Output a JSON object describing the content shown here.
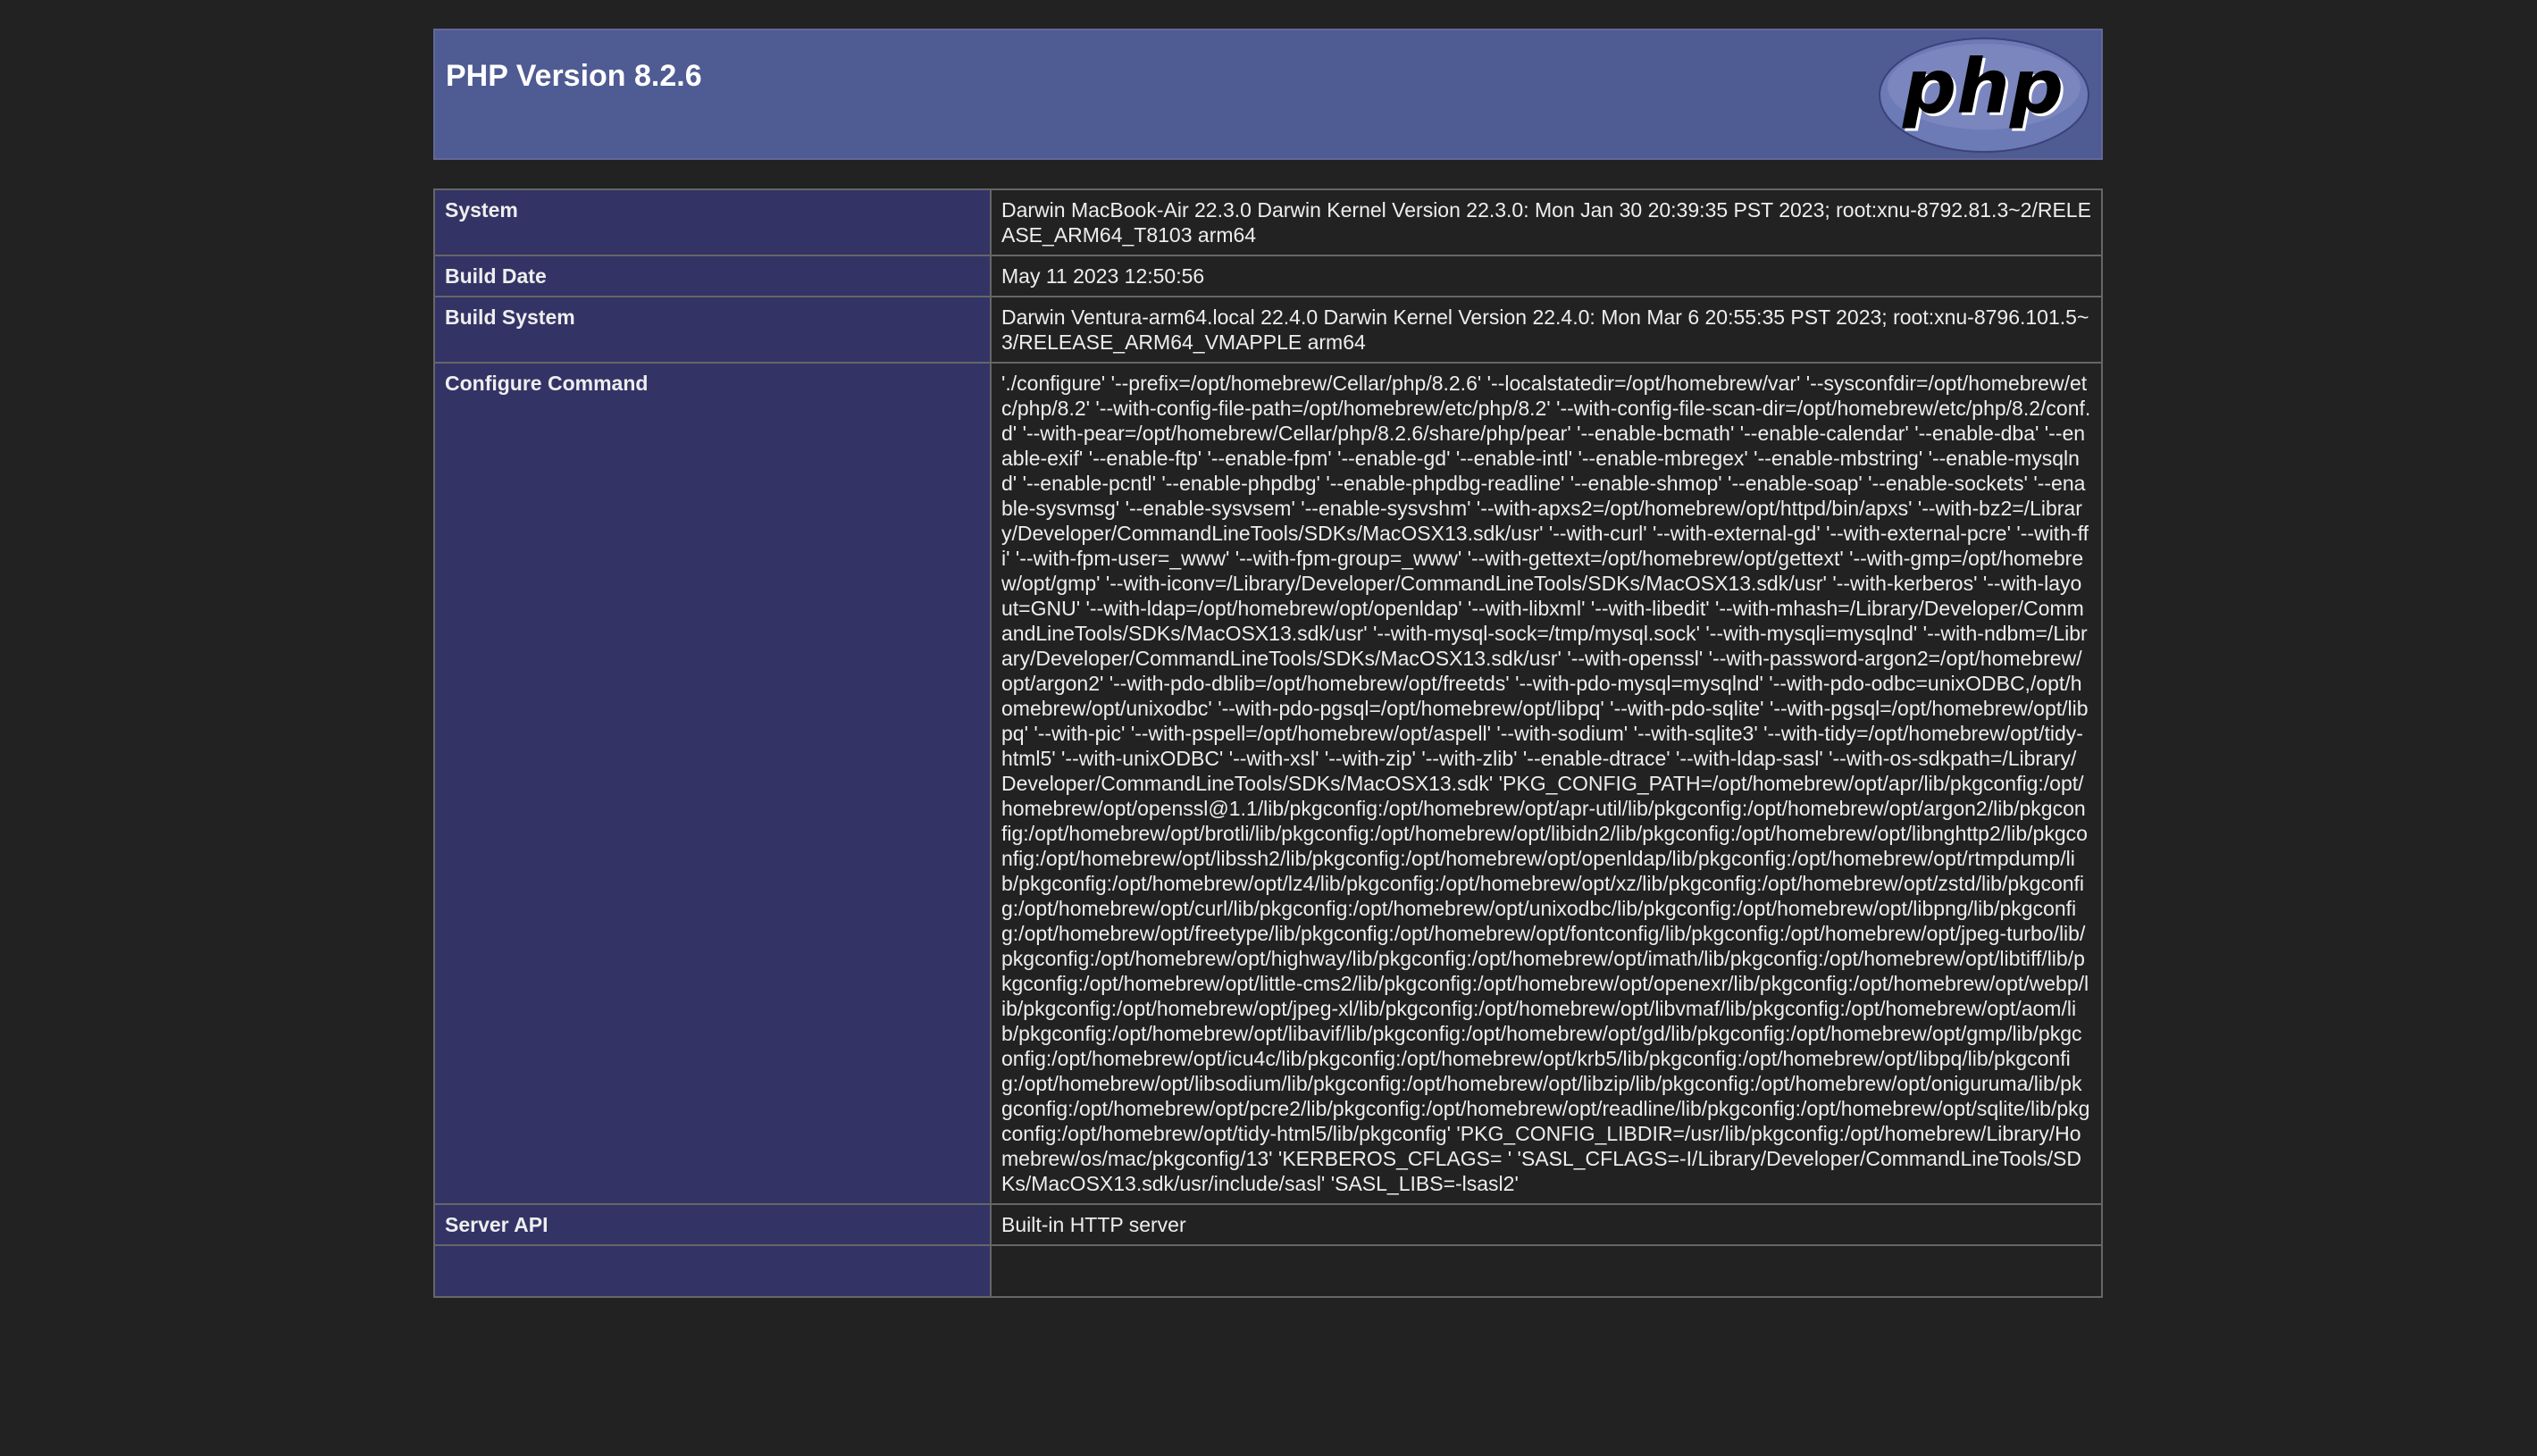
{
  "header": {
    "title": "PHP Version 8.2.6",
    "logo_text": "php",
    "colors": {
      "header_bg": "#4f5b93",
      "label_cell_bg": "#333366",
      "page_bg": "#222222",
      "logo_fill": "#6c7ab5"
    }
  },
  "rows": [
    {
      "label": "System",
      "value": "Darwin MacBook-Air 22.3.0 Darwin Kernel Version 22.3.0: Mon Jan 30 20:39:35 PST 2023; root:xnu-8792.81.3~2/RELEASE_ARM64_T8103 arm64"
    },
    {
      "label": "Build Date",
      "value": "May 11 2023 12:50:56"
    },
    {
      "label": "Build System",
      "value": "Darwin Ventura-arm64.local 22.4.0 Darwin Kernel Version 22.4.0: Mon Mar 6 20:55:35 PST 2023; root:xnu-8796.101.5~3/RELEASE_ARM64_VMAPPLE arm64"
    },
    {
      "label": "Configure Command",
      "value": "'./configure' '--prefix=/opt/homebrew/Cellar/php/8.2.6' '--localstatedir=/opt/homebrew/var' '--sysconfdir=/opt/homebrew/etc/php/8.2' '--with-config-file-path=/opt/homebrew/etc/php/8.2' '--with-config-file-scan-dir=/opt/homebrew/etc/php/8.2/conf.d' '--with-pear=/opt/homebrew/Cellar/php/8.2.6/share/php/pear' '--enable-bcmath' '--enable-calendar' '--enable-dba' '--enable-exif' '--enable-ftp' '--enable-fpm' '--enable-gd' '--enable-intl' '--enable-mbregex' '--enable-mbstring' '--enable-mysqlnd' '--enable-pcntl' '--enable-phpdbg' '--enable-phpdbg-readline' '--enable-shmop' '--enable-soap' '--enable-sockets' '--enable-sysvmsg' '--enable-sysvsem' '--enable-sysvshm' '--with-apxs2=/opt/homebrew/opt/httpd/bin/apxs' '--with-bz2=/Library/Developer/CommandLineTools/SDKs/MacOSX13.sdk/usr' '--with-curl' '--with-external-gd' '--with-external-pcre' '--with-ffi' '--with-fpm-user=_www' '--with-fpm-group=_www' '--with-gettext=/opt/homebrew/opt/gettext' '--with-gmp=/opt/homebrew/opt/gmp' '--with-iconv=/Library/Developer/CommandLineTools/SDKs/MacOSX13.sdk/usr' '--with-kerberos' '--with-layout=GNU' '--with-ldap=/opt/homebrew/opt/openldap' '--with-libxml' '--with-libedit' '--with-mhash=/Library/Developer/CommandLineTools/SDKs/MacOSX13.sdk/usr' '--with-mysql-sock=/tmp/mysql.sock' '--with-mysqli=mysqlnd' '--with-ndbm=/Library/Developer/CommandLineTools/SDKs/MacOSX13.sdk/usr' '--with-openssl' '--with-password-argon2=/opt/homebrew/opt/argon2' '--with-pdo-dblib=/opt/homebrew/opt/freetds' '--with-pdo-mysql=mysqlnd' '--with-pdo-odbc=unixODBC,/opt/homebrew/opt/unixodbc' '--with-pdo-pgsql=/opt/homebrew/opt/libpq' '--with-pdo-sqlite' '--with-pgsql=/opt/homebrew/opt/libpq' '--with-pic' '--with-pspell=/opt/homebrew/opt/aspell' '--with-sodium' '--with-sqlite3' '--with-tidy=/opt/homebrew/opt/tidy-html5' '--with-unixODBC' '--with-xsl' '--with-zip' '--with-zlib' '--enable-dtrace' '--with-ldap-sasl' '--with-os-sdkpath=/Library/Developer/CommandLineTools/SDKs/MacOSX13.sdk' 'PKG_CONFIG_PATH=/opt/homebrew/opt/apr/lib/pkgconfig:/opt/homebrew/opt/openssl@1.1/lib/pkgconfig:/opt/homebrew/opt/apr-util/lib/pkgconfig:/opt/homebrew/opt/argon2/lib/pkgconfig:/opt/homebrew/opt/brotli/lib/pkgconfig:/opt/homebrew/opt/libidn2/lib/pkgconfig:/opt/homebrew/opt/libnghttp2/lib/pkgconfig:/opt/homebrew/opt/libssh2/lib/pkgconfig:/opt/homebrew/opt/openldap/lib/pkgconfig:/opt/homebrew/opt/rtmpdump/lib/pkgconfig:/opt/homebrew/opt/lz4/lib/pkgconfig:/opt/homebrew/opt/xz/lib/pkgconfig:/opt/homebrew/opt/zstd/lib/pkgconfig:/opt/homebrew/opt/curl/lib/pkgconfig:/opt/homebrew/opt/unixodbc/lib/pkgconfig:/opt/homebrew/opt/libpng/lib/pkgconfig:/opt/homebrew/opt/freetype/lib/pkgconfig:/opt/homebrew/opt/fontconfig/lib/pkgconfig:/opt/homebrew/opt/jpeg-turbo/lib/pkgconfig:/opt/homebrew/opt/highway/lib/pkgconfig:/opt/homebrew/opt/imath/lib/pkgconfig:/opt/homebrew/opt/libtiff/lib/pkgconfig:/opt/homebrew/opt/little-cms2/lib/pkgconfig:/opt/homebrew/opt/openexr/lib/pkgconfig:/opt/homebrew/opt/webp/lib/pkgconfig:/opt/homebrew/opt/jpeg-xl/lib/pkgconfig:/opt/homebrew/opt/libvmaf/lib/pkgconfig:/opt/homebrew/opt/aom/lib/pkgconfig:/opt/homebrew/opt/libavif/lib/pkgconfig:/opt/homebrew/opt/gd/lib/pkgconfig:/opt/homebrew/opt/gmp/lib/pkgconfig:/opt/homebrew/opt/icu4c/lib/pkgconfig:/opt/homebrew/opt/krb5/lib/pkgconfig:/opt/homebrew/opt/libpq/lib/pkgconfig:/opt/homebrew/opt/libsodium/lib/pkgconfig:/opt/homebrew/opt/libzip/lib/pkgconfig:/opt/homebrew/opt/oniguruma/lib/pkgconfig:/opt/homebrew/opt/pcre2/lib/pkgconfig:/opt/homebrew/opt/readline/lib/pkgconfig:/opt/homebrew/opt/sqlite/lib/pkgconfig:/opt/homebrew/opt/tidy-html5/lib/pkgconfig' 'PKG_CONFIG_LIBDIR=/usr/lib/pkgconfig:/opt/homebrew/Library/Homebrew/os/mac/pkgconfig/13' 'KERBEROS_CFLAGS= ' 'SASL_CFLAGS=-I/Library/Developer/CommandLineTools/SDKs/MacOSX13.sdk/usr/include/sasl' 'SASL_LIBS=-lsasl2'"
    },
    {
      "label": "Server API",
      "value": "Built-in HTTP server"
    },
    {
      "label": "",
      "value": ""
    }
  ]
}
